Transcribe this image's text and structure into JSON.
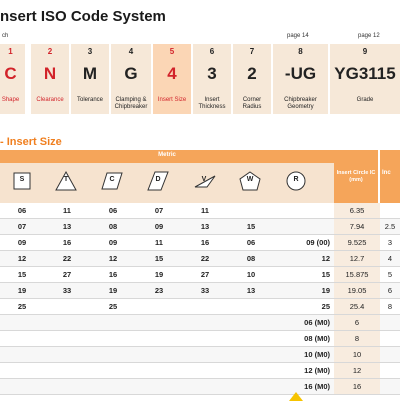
{
  "title": "nsert ISO Code System",
  "ref_left": "ch",
  "page_refs": [
    "page 14",
    "page 12"
  ],
  "codes": [
    {
      "num": "1",
      "letter": "C",
      "caption": "Shape",
      "red": true,
      "hl": false
    },
    {
      "num": "2",
      "letter": "N",
      "caption": "Clearance",
      "red": true,
      "hl": false
    },
    {
      "num": "3",
      "letter": "M",
      "caption": "Tolerance",
      "red": false,
      "hl": false
    },
    {
      "num": "4",
      "letter": "G",
      "caption": "Clamping & Chipbreaker",
      "red": false,
      "hl": false
    },
    {
      "num": "5",
      "letter": "4",
      "caption": "Insert Size",
      "red": true,
      "hl": true
    },
    {
      "num": "6",
      "letter": "3",
      "caption": "Insert Thickness",
      "red": false,
      "hl": false
    },
    {
      "num": "7",
      "letter": "2",
      "caption": "Corner Radius",
      "red": false,
      "hl": false
    },
    {
      "num": "8",
      "letter": "-UG",
      "caption": "Chipbreaker Geometry",
      "red": false,
      "hl": false
    },
    {
      "num": "9",
      "letter": "YG3115",
      "caption": "Grade",
      "red": false,
      "hl": false
    }
  ],
  "section_title": "- Insert Size",
  "table": {
    "metric_label": "Metric",
    "ic_header": "Insert Circle IC (mm)",
    "ext_header": "Inc",
    "shapes": [
      "S",
      "T",
      "C",
      "D",
      "V",
      "W",
      "R"
    ],
    "rows": [
      [
        "06",
        "11",
        "06",
        "07",
        "11",
        "",
        "",
        "6.35",
        ""
      ],
      [
        "07",
        "13",
        "08",
        "09",
        "13",
        "15",
        "",
        "7.94",
        "2.5"
      ],
      [
        "09",
        "16",
        "09",
        "11",
        "16",
        "06",
        "09 (00)",
        "9.525",
        "3"
      ],
      [
        "12",
        "22",
        "12",
        "15",
        "22",
        "08",
        "12",
        "12.7",
        "4"
      ],
      [
        "15",
        "27",
        "16",
        "19",
        "27",
        "10",
        "15",
        "15.875",
        "5"
      ],
      [
        "19",
        "33",
        "19",
        "23",
        "33",
        "13",
        "19",
        "19.05",
        "6"
      ],
      [
        "25",
        "",
        "25",
        "",
        "",
        "",
        "25",
        "25.4",
        "8"
      ],
      [
        "",
        "",
        "",
        "",
        "",
        "",
        "06 (M0)",
        "6",
        ""
      ],
      [
        "",
        "",
        "",
        "",
        "",
        "",
        "08 (M0)",
        "8",
        ""
      ],
      [
        "",
        "",
        "",
        "",
        "",
        "",
        "10 (M0)",
        "10",
        ""
      ],
      [
        "",
        "",
        "",
        "",
        "",
        "",
        "12 (M0)",
        "12",
        ""
      ],
      [
        "",
        "",
        "",
        "",
        "",
        "",
        "16 (M0)",
        "16",
        ""
      ]
    ]
  },
  "colors": {
    "accent": "#f07f1f",
    "red": "#d2232a",
    "header": "#f5a55a",
    "tan": "#f6e8d8"
  }
}
